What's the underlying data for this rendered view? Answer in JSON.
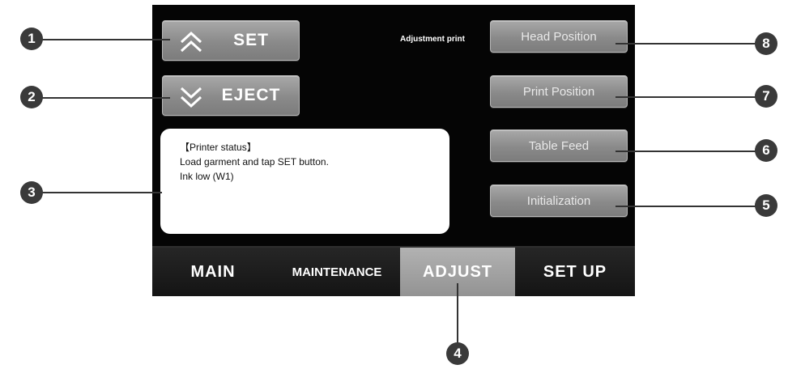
{
  "buttons": {
    "set": "SET",
    "eject": "EJECT"
  },
  "adjustment_label": "Adjustment print",
  "side_buttons": {
    "head_position": "Head Position",
    "print_position": "Print Position",
    "table_feed": "Table Feed",
    "initialization": "Initialization"
  },
  "status": {
    "header": "【Printer status】",
    "line1": "Load garment and tap SET button.",
    "line2": "Ink low (W1)"
  },
  "tabs": {
    "main": "MAIN",
    "maintenance": "MAINTENANCE",
    "adjust": "ADJUST",
    "setup": "SET UP",
    "active": "adjust"
  },
  "callouts": {
    "c1": "1",
    "c2": "2",
    "c3": "3",
    "c4": "4",
    "c5": "5",
    "c6": "6",
    "c7": "7",
    "c8": "8"
  },
  "colors": {
    "screen_bg": "#050505",
    "button": "#8e8e8e",
    "active_tab": "#a3a3a3",
    "callout": "#3a3a3a"
  },
  "icons": {
    "set": "double-chevron-up-icon",
    "eject": "double-chevron-down-icon"
  }
}
